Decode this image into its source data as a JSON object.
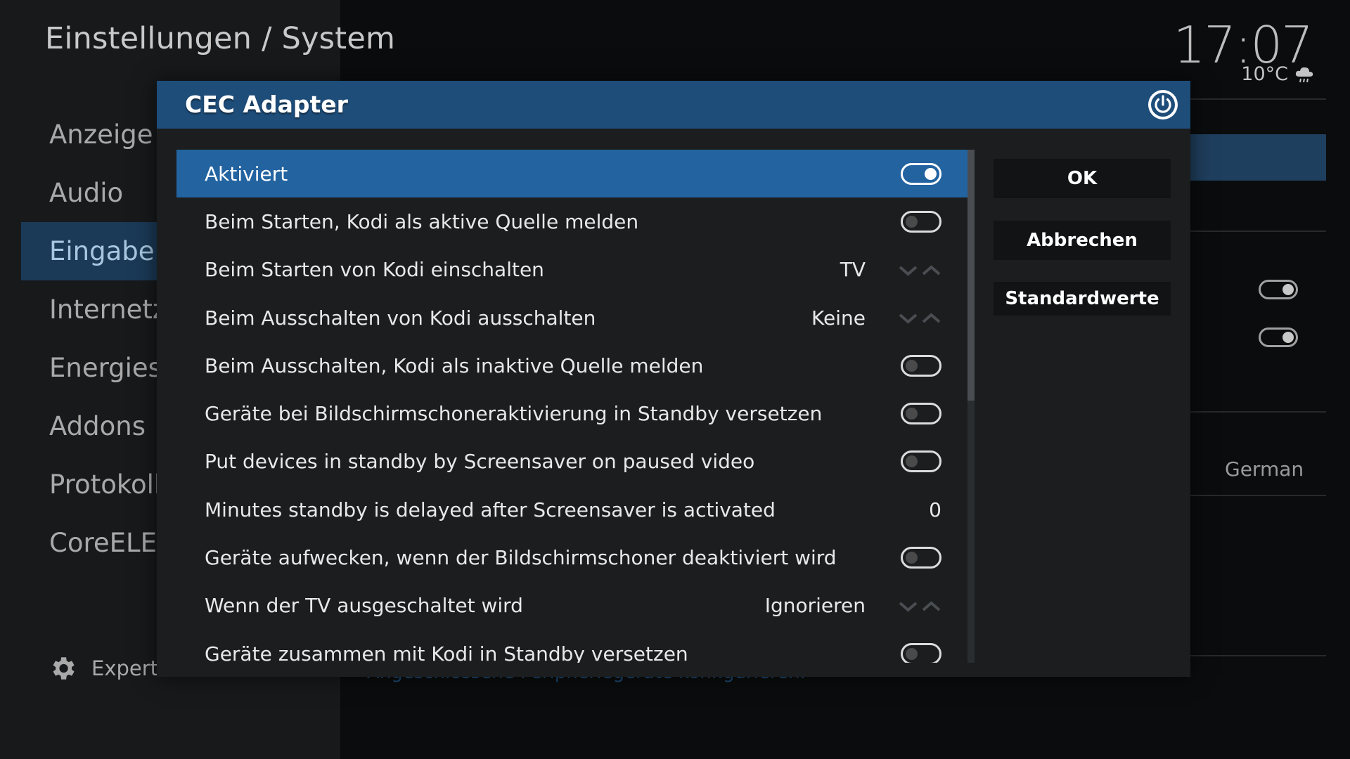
{
  "header": {
    "title": "Einstellungen / System",
    "time": "17:07",
    "temperature": "10°C",
    "weather_icon": "cloud-rain-icon"
  },
  "sidebar": {
    "items": [
      {
        "label": "Anzeige"
      },
      {
        "label": "Audio"
      },
      {
        "label": "Eingabe"
      },
      {
        "label": "Internetzu"
      },
      {
        "label": "Energiesp"
      },
      {
        "label": "Addons"
      },
      {
        "label": "Protokolli"
      },
      {
        "label": "CoreELEC"
      }
    ],
    "active_index": 2,
    "expert_label": "Experte",
    "expert_icon": "gear-icon"
  },
  "background": {
    "german_label": "German",
    "hint": "Angeschlossene Peripheriegeräte konfigurieren."
  },
  "dialog": {
    "title": "CEC Adapter",
    "title_icon": "power-icon",
    "rows": [
      {
        "label": "Aktiviert",
        "type": "toggle",
        "on": true,
        "selected": true
      },
      {
        "label": "Beim Starten, Kodi als aktive Quelle melden",
        "type": "toggle",
        "on": false
      },
      {
        "label": "Beim Starten von Kodi einschalten",
        "type": "spinner",
        "value": "TV"
      },
      {
        "label": "Beim Ausschalten von Kodi ausschalten",
        "type": "spinner",
        "value": "Keine"
      },
      {
        "label": "Beim Ausschalten, Kodi als inaktive Quelle melden",
        "type": "toggle",
        "on": false
      },
      {
        "label": "Geräte bei Bildschirmschoneraktivierung in Standby versetzen",
        "type": "toggle",
        "on": false
      },
      {
        "label": "Put devices in standby by Screensaver on paused video",
        "type": "toggle",
        "on": false
      },
      {
        "label": "Minutes standby is delayed after Screensaver is activated",
        "type": "number",
        "value": "0"
      },
      {
        "label": "Geräte aufwecken, wenn der Bildschirmschoner deaktiviert wird",
        "type": "toggle",
        "on": false
      },
      {
        "label": "Wenn der TV ausgeschaltet wird",
        "type": "spinner",
        "value": "Ignorieren"
      },
      {
        "label": "Geräte zusammen mit Kodi in Standby versetzen",
        "type": "toggle",
        "on": false
      }
    ],
    "buttons": {
      "ok": "OK",
      "cancel": "Abbrechen",
      "defaults": "Standardwerte"
    }
  }
}
